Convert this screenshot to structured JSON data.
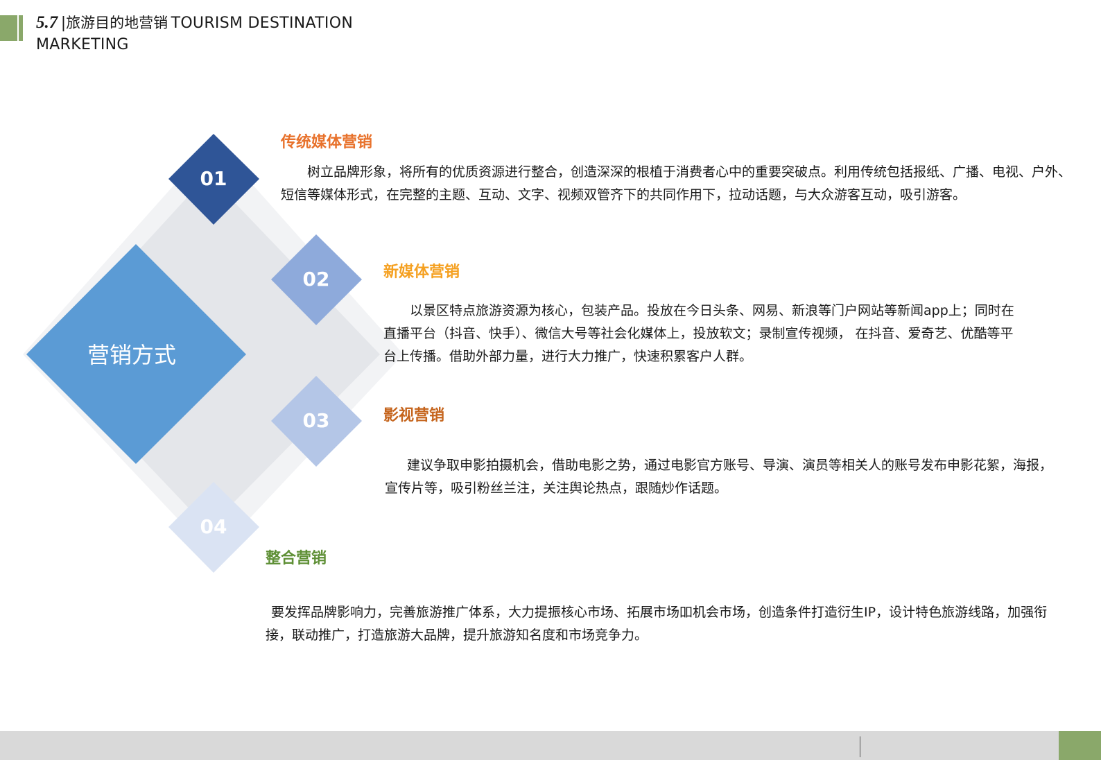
{
  "header": {
    "section_number": "5.7",
    "separator": "|",
    "title_cn": "旅游目的地营销",
    "title_en_line1": "TOURISM DESTINATION",
    "title_en_line2": "MARKETING"
  },
  "center": {
    "label": "营销方式"
  },
  "items": [
    {
      "number": "01",
      "title": "传统媒体营销",
      "title_color": "#e8722c",
      "diamond_color": "#2f5597",
      "text": "树立品牌形象，将所有的优质资源进行整合，创造深深的根植于消费者心中的重要突破点。利用传统包括报纸、广播、电视、户外、短信等媒体形式，在完整的主题、互动、文字、视频双管齐下的共同作用下，拉动话题，与大众游客互动，吸引游客。"
    },
    {
      "number": "02",
      "title": "新媒体营销",
      "title_color": "#f5a020",
      "diamond_color": "#8eaadb",
      "text": "以景区特点旅游资源为核心，包装产品。投放在今日头条、网易、新浪等门户网站等新闻app上；同时在直播平台（抖音、快手）、微信大号等社会化媒体上，投放软文；录制宣传视频，  在抖音、爱奇艺、优酷等平台上传播。借助外部力量，进行大力推广，快速积累客户人群。"
    },
    {
      "number": "03",
      "title": "影视营销",
      "title_color": "#c5641c",
      "diamond_color": "#b4c6e7",
      "text": "建议争取申影拍摄机会，借助电影之势，通过电影官方账号、导演、演员等相关人的账号发布申影花絮，海报，宣传片等，吸引粉丝兰注，关注舆论热点，跟随炒作话题。"
    },
    {
      "number": "04",
      "title": "整合营销",
      "title_color": "#5e8f35",
      "diamond_color": "#dae3f3",
      "text": "要发挥品牌影响力，完善旅游推广体系，大力提振核心市场、拓展市场吅机会市场，创造条件打造衍生IP，设计特色旅游线路，加强衔接，联动推广，打造旅游大品牌，提升旅游知名度和市场竞争力。"
    }
  ],
  "colors": {
    "accent_green": "#8aa86a",
    "center_diamond": "#5b9bd5",
    "backdrop_outer": "#f2f3f5",
    "backdrop_inner": "#e4e6ea",
    "footer_bar": "#d9d9d9"
  }
}
